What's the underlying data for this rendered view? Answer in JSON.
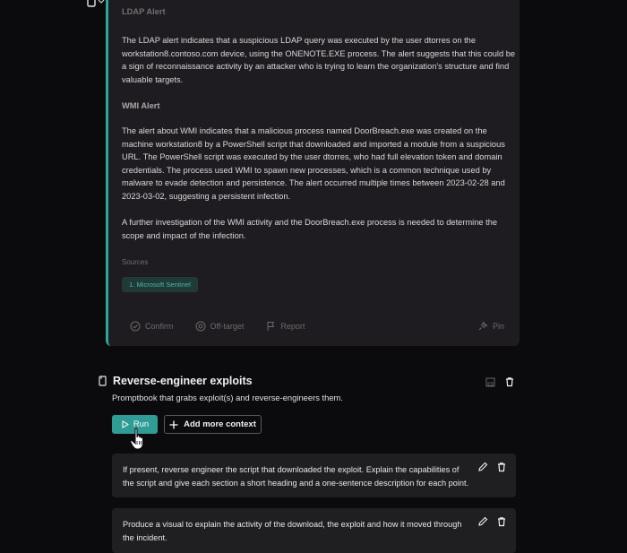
{
  "toolbar": {
    "icons": [
      "clipboard-icon",
      "chevron-down-icon",
      "pin-icon",
      "rerun-icon",
      "delete-icon",
      "export-icon"
    ]
  },
  "response": {
    "ldap_heading": "LDAP Alert",
    "ldap_lines": [
      "The LDAP alert indicates that a suspicious LDAP query was executed by the user dtorres on the",
      "workstation8.contoso.com  device, using the ONENOTE.EXE process. The alert suggests that this could be",
      "a sign of reconnaissance activity by an attacker who is trying to learn the organization's structure and find",
      "valuable targets."
    ],
    "wmi_heading": "WMI Alert",
    "wmi_lines": [
      "The alert about WMI indicates that a malicious process named DoorBreach.exe was created on the",
      "machine workstation8 by a PowerShell script that downloaded and imported a module from a suspicious",
      "URL. The PowerShell script was executed by the user dtorres, who had full elevation token and domain",
      "credentials. The process used WMI to spawn new processes, which is a common technique used by",
      "malware to evade detection and persistence. The alert occurred multiple times between 2023-02-28 and",
      "2023-03-02, suggesting a persistent infection."
    ],
    "further_lines": [
      "A further investigation of the WMI activity and the DoorBreach.exe process is needed to determine the",
      "scope and impact of the infection."
    ],
    "sources_label": "Sources",
    "source_chip": "1. Microsoft Sentinel",
    "actions": {
      "confirm": "Confirm",
      "off_target": "Off-target",
      "report": "Report",
      "pin": "Pin"
    }
  },
  "promptbook": {
    "title": "Reverse-engineer exploits",
    "description": "Promptbook that grabs exploit(s) and reverse-engineers them.",
    "run_label": "Run",
    "add_context_label": "Add more context",
    "prompts": [
      {
        "lines": [
          "If present, reverse engineer the script that downloaded the exploit. Explain the capabilities of",
          "the script and give each section a short heading and a one-sentence description for each point."
        ]
      },
      {
        "lines": [
          "Produce a visual to explain the activity of the download, the exploit and how it moved through",
          "the incident."
        ]
      }
    ]
  },
  "colors": {
    "accent": "#2f9c96",
    "card_bg": "#1e1c20",
    "page_bg": "#0b0b0d"
  }
}
